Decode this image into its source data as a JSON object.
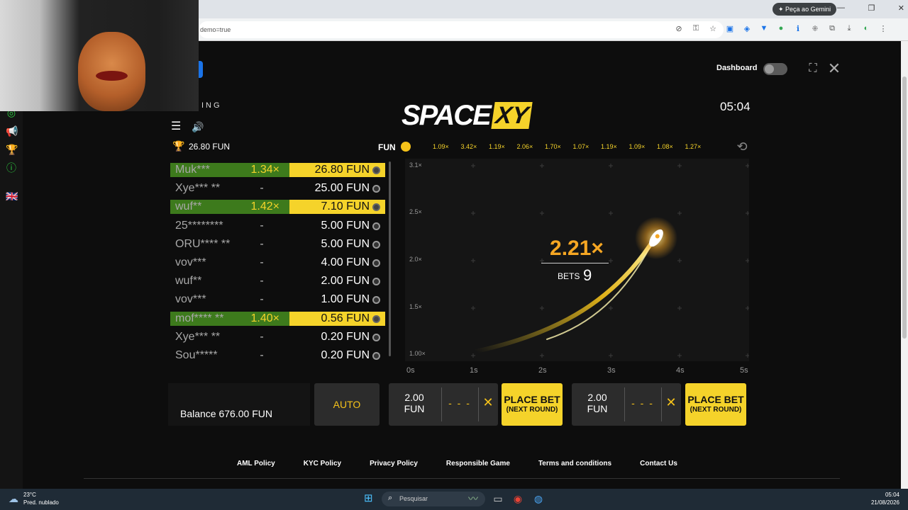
{
  "browser": {
    "gemini_button": "Peça ao Gemini",
    "address": "demo=true",
    "window_controls": [
      "—",
      "❐",
      "✕"
    ]
  },
  "page": {
    "dashboard_label": "Dashboard",
    "brand_small": "ING",
    "logo_space": "SPACE",
    "logo_xy": "XY",
    "clock": "05:04",
    "top_win": "26.80 FUN",
    "currency": "FUN",
    "history": [
      "1.09×",
      "3.42×",
      "1.19×",
      "2.06×",
      "1.70×",
      "1.07×",
      "1.19×",
      "1.09×",
      "1.08×",
      "1.27×"
    ]
  },
  "bets": [
    {
      "name": "Muk***",
      "mult": "1.34×",
      "amount": "26.80 FUN",
      "won": true
    },
    {
      "name": "Xye*** **",
      "mult": "-",
      "amount": "25.00 FUN",
      "won": false
    },
    {
      "name": "wuf**",
      "mult": "1.42×",
      "amount": "7.10 FUN",
      "won": true
    },
    {
      "name": "25********",
      "mult": "-",
      "amount": "5.00 FUN",
      "won": false
    },
    {
      "name": "ORU**** **",
      "mult": "-",
      "amount": "5.00 FUN",
      "won": false
    },
    {
      "name": "vov***",
      "mult": "-",
      "amount": "4.00 FUN",
      "won": false
    },
    {
      "name": "wuf**",
      "mult": "-",
      "amount": "2.00 FUN",
      "won": false
    },
    {
      "name": "vov***",
      "mult": "-",
      "amount": "1.00 FUN",
      "won": false
    },
    {
      "name": "mof**** **",
      "mult": "1.40×",
      "amount": "0.56 FUN",
      "won": true
    },
    {
      "name": "Xye*** **",
      "mult": "-",
      "amount": "0.20 FUN",
      "won": false
    },
    {
      "name": "Sou*****",
      "mult": "-",
      "amount": "0.20 FUN",
      "won": false
    }
  ],
  "chart": {
    "y_ticks": [
      "3.1×",
      "2.5×",
      "2.0×",
      "1.5×",
      "1.00×"
    ],
    "x_ticks": [
      "0s",
      "1s",
      "2s",
      "3s",
      "4s",
      "5s"
    ],
    "multiplier": "2.21×",
    "bets_label": "BETS",
    "bets_count": "9"
  },
  "controls": {
    "balance": "Balance 676.00 FUN",
    "auto": "AUTO",
    "panel1_amount": "2.00",
    "panel1_unit": "FUN",
    "panel1_dashes": "- - -",
    "panel2_amount": "2.00",
    "panel2_unit": "FUN",
    "panel2_dashes": "- - -",
    "place_bet": "PLACE BET",
    "next_round": "(NEXT ROUND)"
  },
  "footer": [
    "AML Policy",
    "KYC Policy",
    "Privacy Policy",
    "Responsible Game",
    "Terms and conditions",
    "Contact Us"
  ],
  "taskbar": {
    "temp": "23°C",
    "weather": "Pred. nublado",
    "search": "Pesquisar",
    "time": "05:04",
    "date": "21/08/2026"
  },
  "colors": {
    "accent_yellow": "#f5d32a",
    "win_green": "#3d7a1c",
    "multiplier_orange": "#f5a623"
  }
}
